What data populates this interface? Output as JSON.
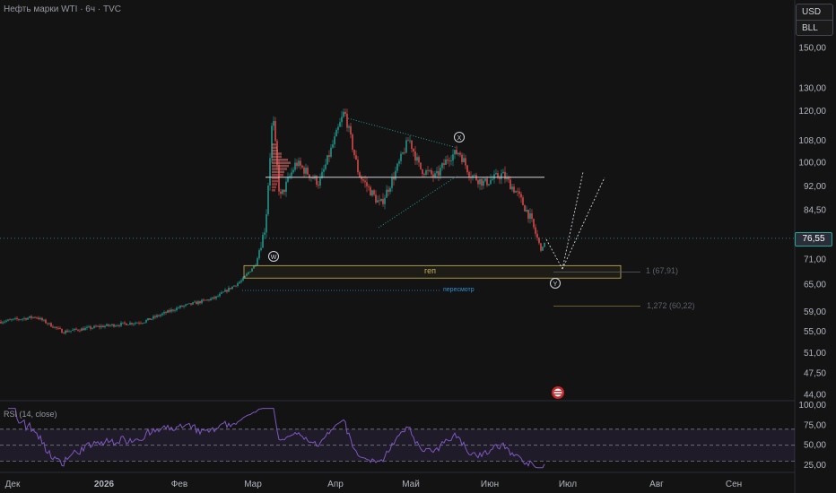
{
  "header": {
    "title": "Нефть марки WTI · 6ч · TVC",
    "currency": "USD",
    "unit": "BLL"
  },
  "rsi": {
    "label": "RSI (14, close)"
  },
  "last_price": "76,55",
  "annotations": {
    "gap": "геп",
    "revisit": "пересмотр",
    "fib1": "1 (67,91)",
    "fib1272": "1,272 (60,22)",
    "wave_w": "W",
    "wave_x": "X",
    "wave_y": "Y"
  },
  "colors": {
    "up": "#26a69a",
    "down": "#ef5350",
    "rsi": "#7e57c2",
    "background": "#131313"
  },
  "chart_data": [
    {
      "type": "candlestick",
      "y_scale": "log",
      "y_ticks": [
        "150,00",
        "130,00",
        "120,00",
        "108,00",
        "100,00",
        "92,00",
        "84,50",
        "76,55",
        "71,00",
        "65,00",
        "59,00",
        "55,00",
        "51,00",
        "47,50",
        "44,00"
      ],
      "x_ticks": [
        "Дек",
        "2026",
        "Фев",
        "Мар",
        "Апр",
        "Май",
        "Июн",
        "Июл",
        "Авг",
        "Сен"
      ],
      "ylim": [
        41,
        170
      ],
      "levels": {
        "resistance": 95.0,
        "gap_top": 69.5,
        "gap_bottom": 66.5,
        "fib_1": 67.91,
        "fib_1272": 60.22
      },
      "approx_closes": [
        {
          "x": "Дек",
          "y": 57
        },
        {
          "x": "2026",
          "y": 56
        },
        {
          "x": "Фев",
          "y": 60
        },
        {
          "x": "Мар",
          "y": 70
        },
        {
          "x": "Мар",
          "y": 118
        },
        {
          "x": "Апр",
          "y": 115
        },
        {
          "x": "Апр",
          "y": 88
        },
        {
          "x": "Май",
          "y": 110
        },
        {
          "x": "Май",
          "y": 92
        },
        {
          "x": "Июн",
          "y": 96
        },
        {
          "x": "Июн",
          "y": 76.55
        }
      ]
    },
    {
      "type": "line",
      "name": "RSI (14, close)",
      "y_ticks": [
        "100,00",
        "75,00",
        "50,00",
        "25,00"
      ],
      "ylim": [
        15,
        100
      ],
      "levels": [
        70,
        50,
        30
      ]
    }
  ]
}
